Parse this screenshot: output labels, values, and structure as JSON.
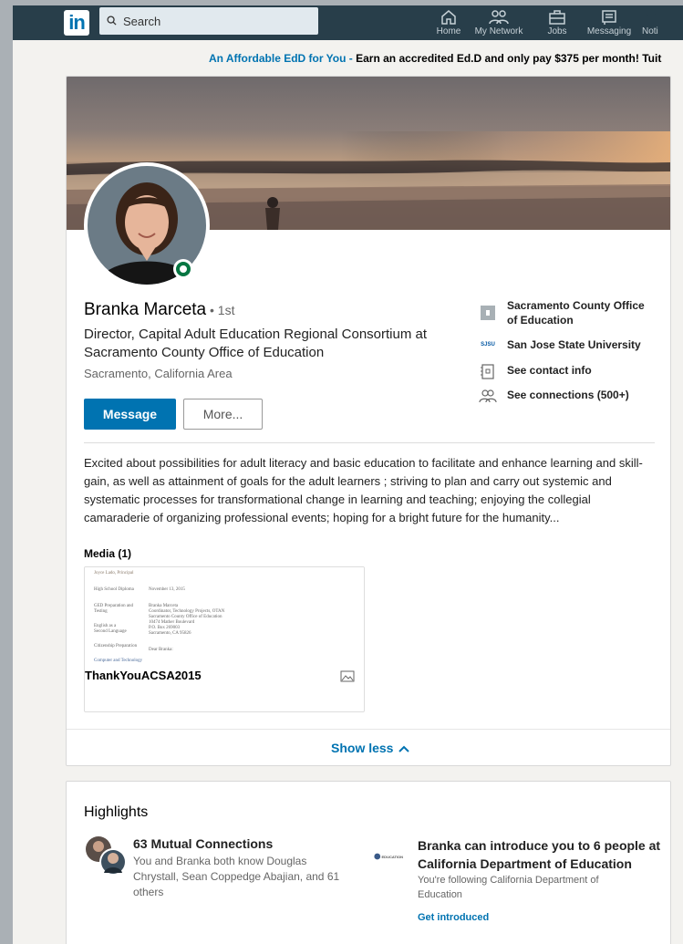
{
  "nav": {
    "logo_text": "in",
    "search_placeholder": "Search",
    "items": [
      {
        "label": "Home",
        "icon": "home-icon"
      },
      {
        "label": "My Network",
        "icon": "network-icon"
      },
      {
        "label": "Jobs",
        "icon": "jobs-icon"
      },
      {
        "label": "Messaging",
        "icon": "messaging-icon"
      },
      {
        "label": "Noti",
        "icon": "notifications-icon"
      }
    ]
  },
  "promo": {
    "link_text": "An Affordable EdD for You",
    "separator": " - ",
    "body_text": "Earn an accredited Ed.D and only pay $375 per month! Tuit"
  },
  "profile": {
    "name": "Branka Marceta",
    "degree": " • 1st",
    "headline": "Director, Capital Adult Education Regional Consortium at Sacramento County Office of Education",
    "location": "Sacramento, California Area",
    "message_button": "Message",
    "more_button": "More...",
    "side": {
      "company": "Sacramento County Office of Education",
      "school": "San Jose State University",
      "school_logo": "SJSU",
      "contact": "See contact info",
      "connections": "See connections (500+)"
    },
    "summary": "Excited about possibilities for adult literacy and basic education to facilitate and enhance learning and skill-gain, as well as attainment of goals for the adult learners ; striving to plan and carry out systemic and systematic processes for transformational change in learning and teaching; enjoying the collegial camaraderie of organizing professional events; hoping for a bright future for the humanity...",
    "media_label": "Media (1)",
    "media_title": "ThankYouACSA2015",
    "show_less": "Show less"
  },
  "highlights": {
    "title": "Highlights",
    "mutual_title": "63 Mutual Connections",
    "mutual_desc": "You and Branka both know Douglas Chrystall, Sean Coppedge Abajian, and 61 others",
    "edu_logo": "EDUCATION",
    "intro_title": "Branka can introduce you to 6 people at California Department of Education",
    "intro_desc": "You're following California Department of Education",
    "intro_link": "Get introduced"
  },
  "colors": {
    "nav_bg": "#283e4a",
    "brand_blue": "#0073b1",
    "online_green": "#057642"
  }
}
